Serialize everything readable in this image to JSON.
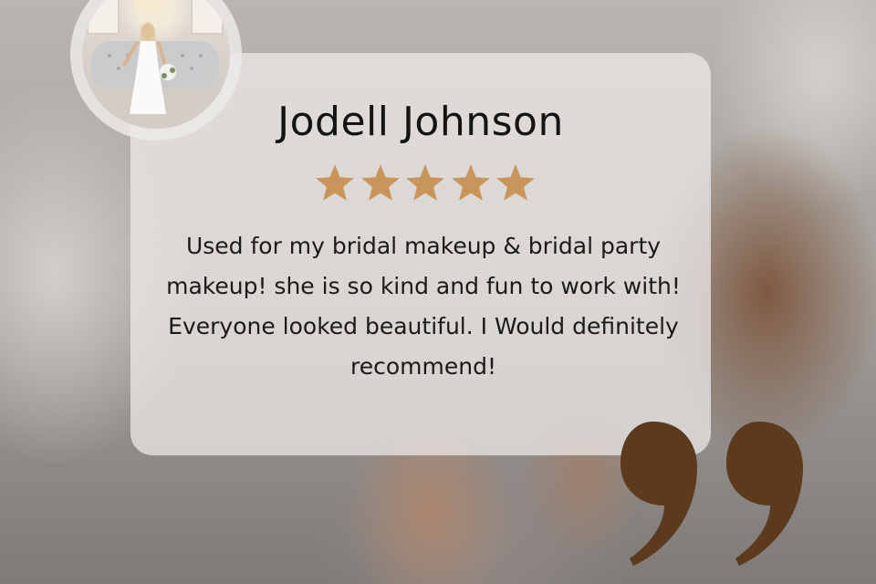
{
  "review": {
    "reviewer_name": "Jodell Johnson",
    "rating": 5,
    "rating_max": 5,
    "text": "Used for my bridal makeup & bridal party makeup! she is so kind and fun to work with! Everyone looked beautiful. I Would definitely recommend!"
  },
  "icons": {
    "star": "star-icon",
    "quote": "closing-quote-icon"
  },
  "colors": {
    "star": "#C9955B",
    "quote": "#5B3A1D",
    "card_background": "#EEECEA",
    "name_text": "#141414"
  }
}
